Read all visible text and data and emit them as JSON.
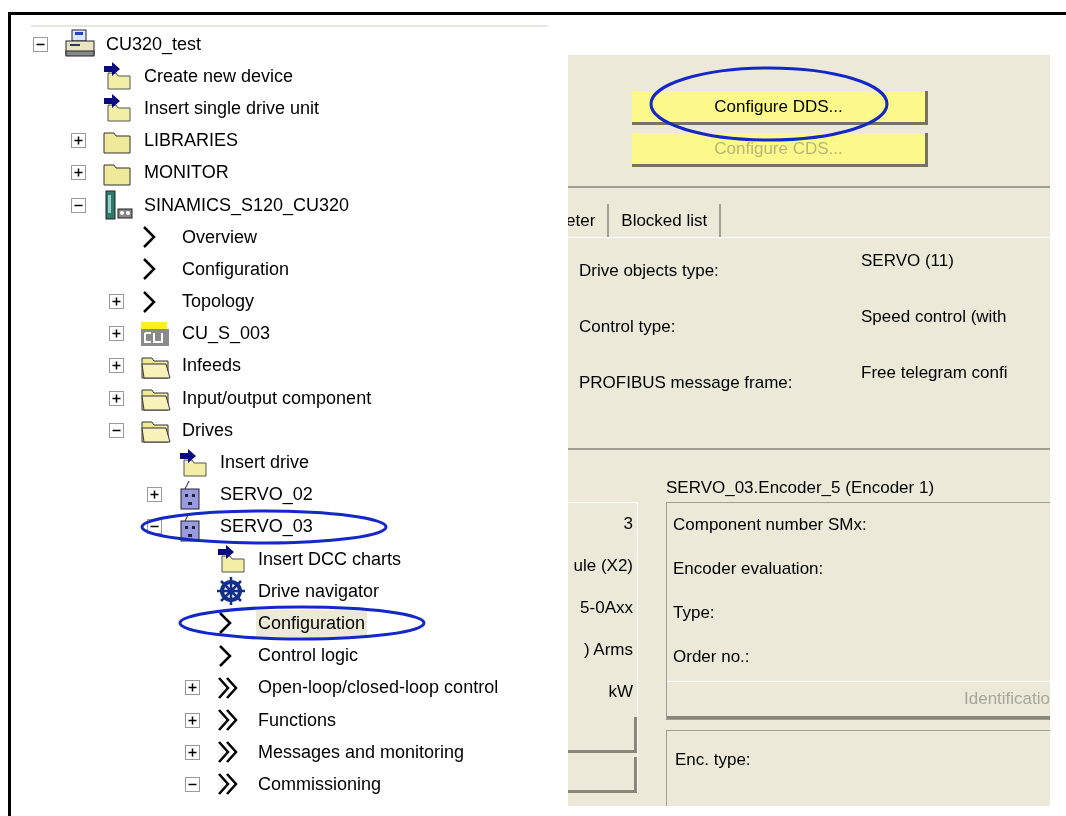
{
  "tree": {
    "items": [
      {
        "label": "CU320_test",
        "kind": "project",
        "expanded": true,
        "selected": false,
        "highlighted": false,
        "children": [
          {
            "label": "Create new device",
            "kind": "insert",
            "selected": false,
            "highlighted": false
          },
          {
            "label": "Insert single drive unit",
            "kind": "insert",
            "selected": false,
            "highlighted": false
          },
          {
            "label": "LIBRARIES",
            "kind": "folder",
            "expanded": false,
            "selected": false,
            "highlighted": false
          },
          {
            "label": "MONITOR",
            "kind": "folder",
            "expanded": false,
            "selected": false,
            "highlighted": false
          },
          {
            "label": "SINAMICS_S120_CU320",
            "kind": "device",
            "expanded": true,
            "selected": false,
            "highlighted": false,
            "children": [
              {
                "label": "Overview",
                "kind": "chevron",
                "selected": false,
                "highlighted": false
              },
              {
                "label": "Configuration",
                "kind": "chevron",
                "selected": false,
                "highlighted": false
              },
              {
                "label": "Topology",
                "kind": "chevron",
                "expanded": false,
                "selected": false,
                "highlighted": false
              },
              {
                "label": "CU_S_003",
                "kind": "chip",
                "expanded": false,
                "selected": false,
                "highlighted": false
              },
              {
                "label": "Infeeds",
                "kind": "openfolder",
                "expanded": false,
                "selected": false,
                "highlighted": false
              },
              {
                "label": "Input/output component",
                "kind": "openfolder",
                "expanded": false,
                "selected": false,
                "highlighted": false
              },
              {
                "label": "Drives",
                "kind": "openfolder",
                "expanded": true,
                "selected": false,
                "highlighted": false,
                "children": [
                  {
                    "label": "Insert drive",
                    "kind": "insert",
                    "selected": false,
                    "highlighted": false
                  },
                  {
                    "label": "SERVO_02",
                    "kind": "motor",
                    "expanded": false,
                    "selected": false,
                    "highlighted": false
                  },
                  {
                    "label": "SERVO_03",
                    "kind": "motor",
                    "expanded": true,
                    "selected": false,
                    "highlighted": true,
                    "children": [
                      {
                        "label": "Insert DCC charts",
                        "kind": "insert",
                        "selected": false,
                        "highlighted": false
                      },
                      {
                        "label": "Drive navigator",
                        "kind": "wheel",
                        "selected": false,
                        "highlighted": false
                      },
                      {
                        "label": "Configuration",
                        "kind": "chevron",
                        "selected": true,
                        "highlighted": true
                      },
                      {
                        "label": "Control logic",
                        "kind": "chevron",
                        "selected": false,
                        "highlighted": false
                      },
                      {
                        "label": "Open-loop/closed-loop control",
                        "kind": "doublechevron",
                        "expanded": false,
                        "selected": false,
                        "highlighted": false
                      },
                      {
                        "label": "Functions",
                        "kind": "doublechevron",
                        "expanded": false,
                        "selected": false,
                        "highlighted": false
                      },
                      {
                        "label": "Messages and monitoring",
                        "kind": "doublechevron",
                        "expanded": false,
                        "selected": false,
                        "highlighted": false
                      },
                      {
                        "label": "Commissioning",
                        "kind": "doublechevron",
                        "expanded": true,
                        "selected": false,
                        "highlighted": false
                      }
                    ]
                  }
                ]
              }
            ]
          }
        ]
      }
    ]
  },
  "panel": {
    "buttons": [
      {
        "label": "Configure DDS...",
        "disabled": false,
        "highlighted": true
      },
      {
        "label": "Configure CDS...",
        "disabled": true,
        "highlighted": false
      }
    ],
    "tabs": [
      {
        "label": "eter",
        "selected": false
      },
      {
        "label": "Blocked list",
        "selected": false
      }
    ],
    "properties": [
      {
        "label": "Drive objects type:",
        "value": "SERVO (11)"
      },
      {
        "label": "Control type:",
        "value": "Speed control (with"
      },
      {
        "label": "PROFIBUS message frame:",
        "value": "Free telegram confi"
      }
    ],
    "left_values": [
      "3",
      "ule (X2)",
      "5-0Axx",
      ") Arms",
      "kW"
    ],
    "encoder": {
      "title": "SERVO_03.Encoder_5 (Encoder 1)",
      "fields": [
        "Component number SMx:",
        "Encoder evaluation:",
        "Type:",
        "Order no.:"
      ],
      "button": {
        "label": "Identificatio",
        "disabled": true
      },
      "enc_type": "Enc. type:"
    }
  }
}
